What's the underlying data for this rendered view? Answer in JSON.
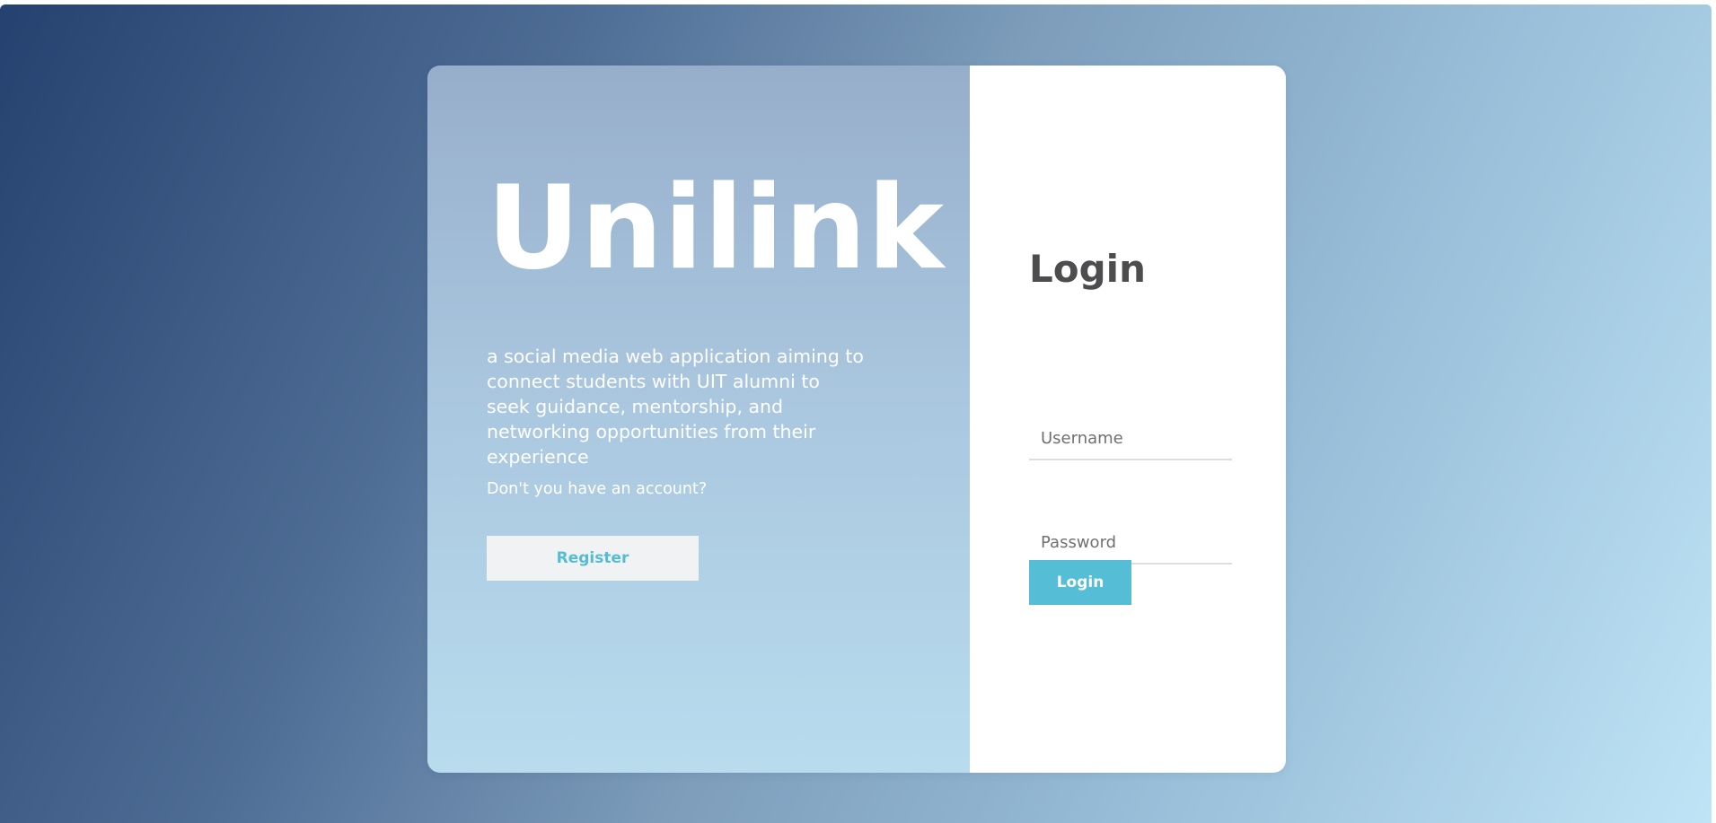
{
  "brand": {
    "name": "Unilink",
    "tagline": "a social media web application aiming to connect students with UIT alumni to seek guidance, mentorship, and networking opportunities from their experience"
  },
  "register": {
    "prompt": "Don't you have an account?",
    "button_label": "Register"
  },
  "login": {
    "title": "Login",
    "username_placeholder": "Username",
    "username_value": "",
    "password_placeholder": "Password",
    "password_value": "",
    "button_label": "Login"
  },
  "colors": {
    "accent": "#55bdd6",
    "title_text": "#4d4d4f",
    "register_button_bg": "#f1f2f4",
    "background_gradient_start": "#25416f",
    "background_gradient_end": "#bfe4f6"
  }
}
